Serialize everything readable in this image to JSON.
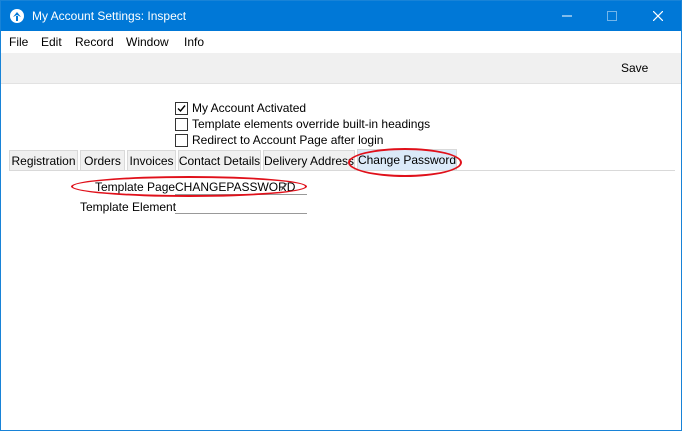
{
  "window": {
    "title": "My Account Settings: Inspect"
  },
  "menu": [
    "File",
    "Edit",
    "Record",
    "Window",
    "Info"
  ],
  "toolbar": {
    "save_label": "Save"
  },
  "checkboxes": [
    {
      "label": "My Account Activated",
      "checked": true
    },
    {
      "label": "Template elements override built-in headings",
      "checked": false
    },
    {
      "label": "Redirect to Account Page after login",
      "checked": false
    }
  ],
  "tabs": [
    "Registration",
    "Orders",
    "Invoices",
    "Contact Details",
    "Delivery Address",
    "Change Password"
  ],
  "active_tab": "Change Password",
  "fields": {
    "template_page": {
      "label": "Template Page",
      "value": "CHANGEPASSWORD"
    },
    "template_element": {
      "label": "Template Element",
      "value": ""
    }
  },
  "colors": {
    "titlebar": "#0078d7",
    "highlight": "#e0101a",
    "active_tab": "#dbeaf9"
  }
}
